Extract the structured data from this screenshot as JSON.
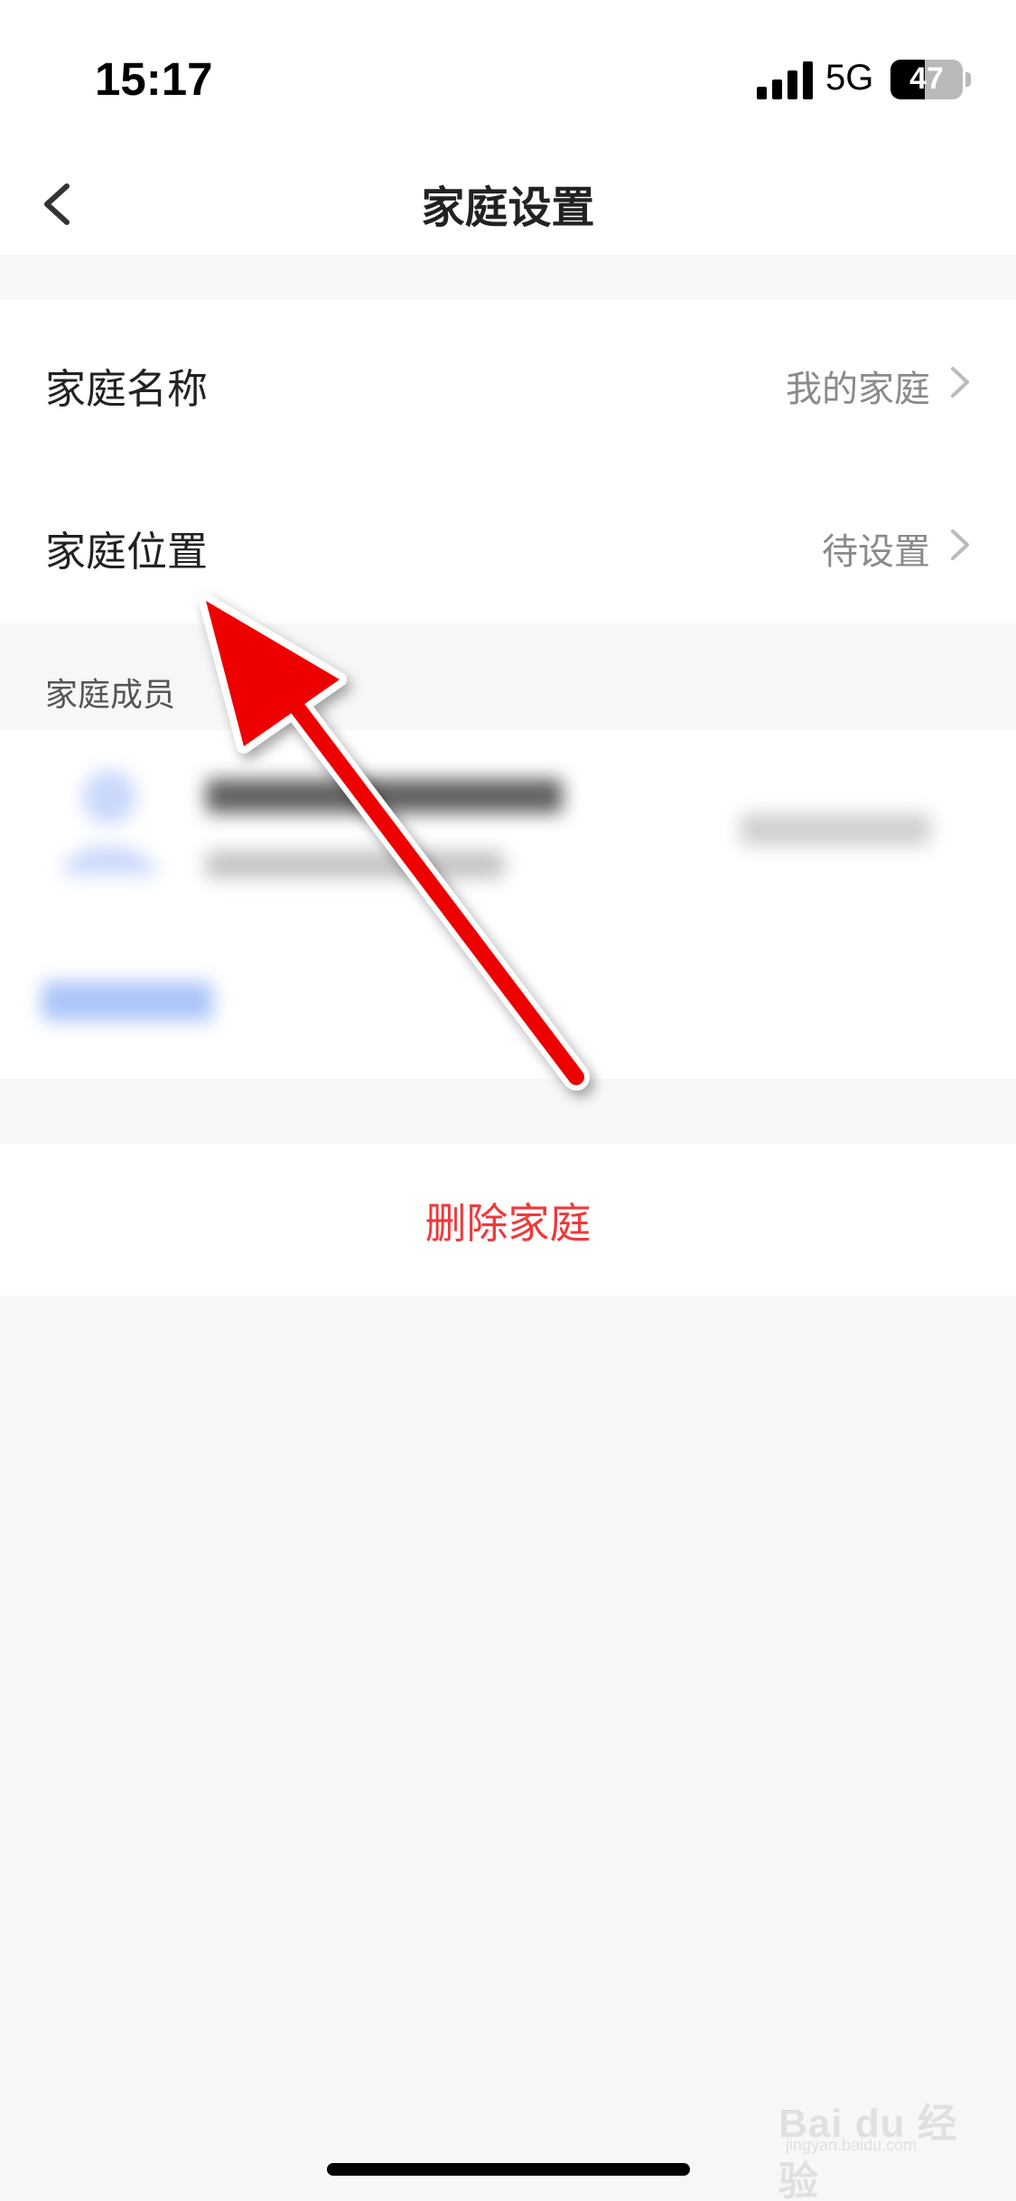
{
  "status_bar": {
    "time": "15:17",
    "network": "5G",
    "battery_level": 47,
    "battery_text": "47"
  },
  "nav": {
    "title": "家庭设置",
    "back_icon": "chevron-left-icon"
  },
  "settings": {
    "rows": [
      {
        "label": "家庭名称",
        "value": "我的家庭"
      },
      {
        "label": "家庭位置",
        "value": "待设置"
      }
    ]
  },
  "members": {
    "section_title": "家庭成员"
  },
  "actions": {
    "delete_label": "删除家庭"
  },
  "colors": {
    "delete_red": "#f0383a",
    "annotation_red": "#ee0000",
    "background": "#f7f7f7"
  },
  "watermark": {
    "text": "Bai du 经验",
    "sub": "jingyan.baidu.com"
  }
}
